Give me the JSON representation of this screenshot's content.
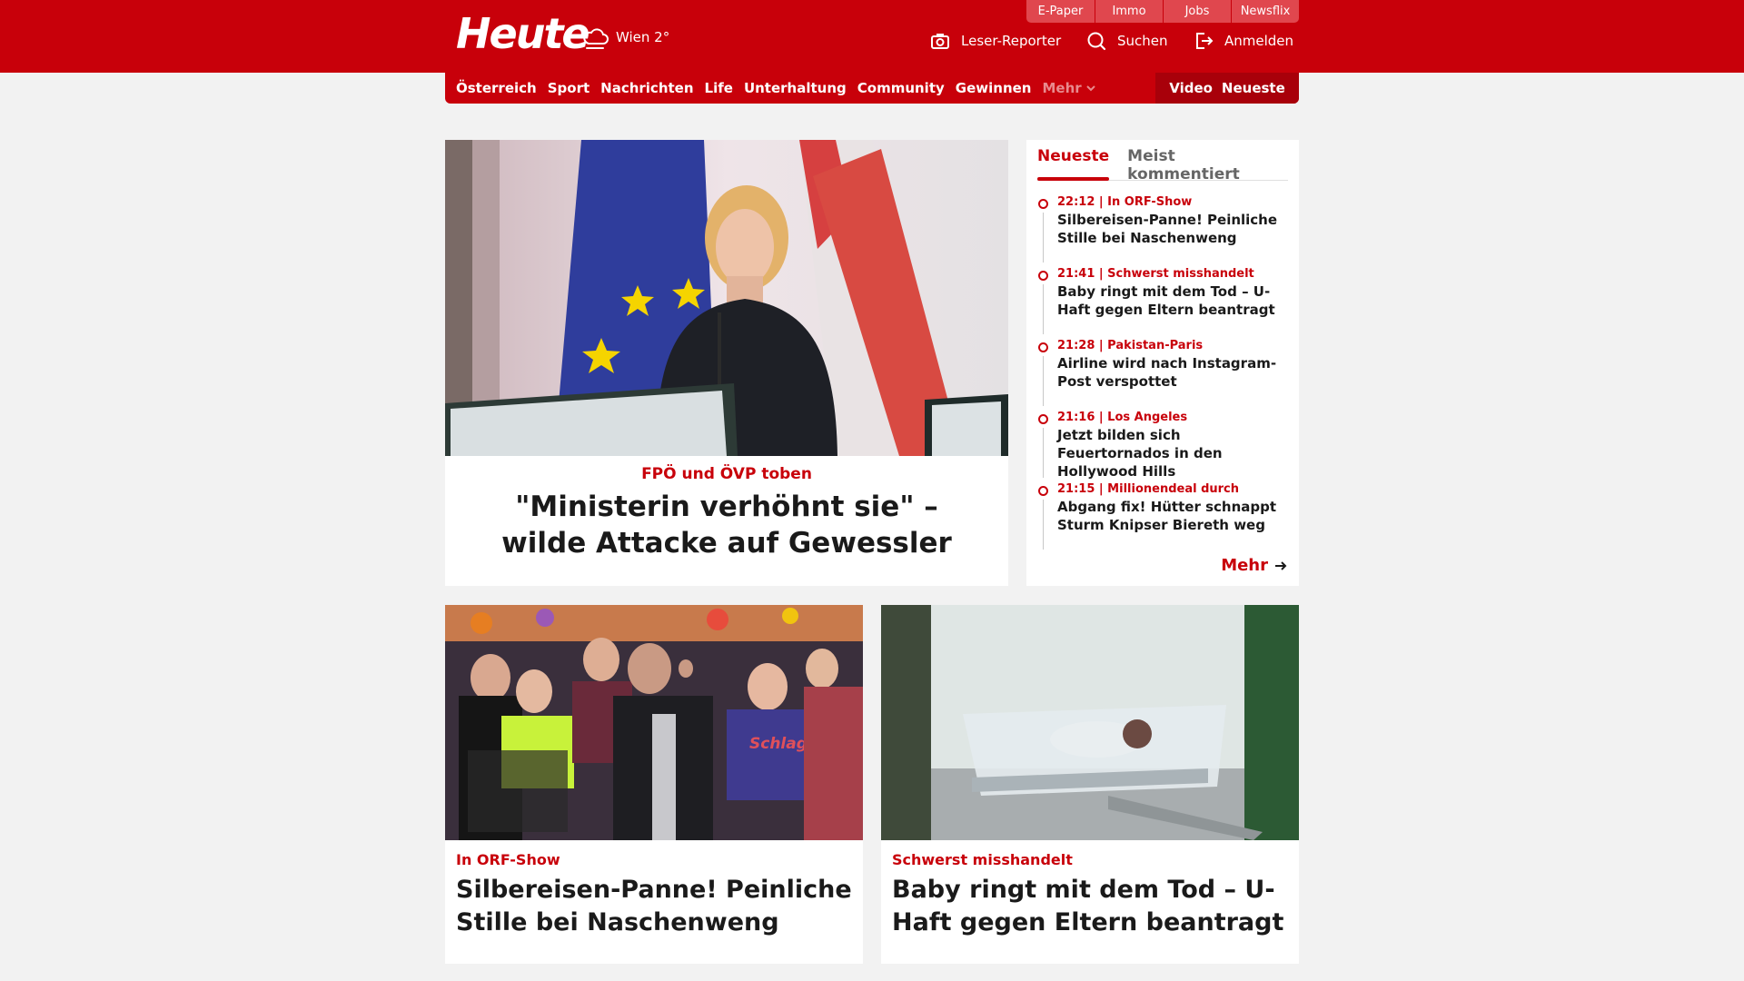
{
  "header": {
    "logo": "Heute",
    "weather": "Wien 2°",
    "quicklinks": [
      "E-Paper",
      "Immo",
      "Jobs",
      "Newsflix"
    ],
    "leser_reporter": "Leser-Reporter",
    "suchen": "Suchen",
    "anmelden": "Anmelden"
  },
  "nav": {
    "items": [
      "Österreich",
      "Sport",
      "Nachrichten",
      "Life",
      "Unterhaltung",
      "Community",
      "Gewinnen"
    ],
    "more": "Mehr",
    "video": "Video",
    "neueste": "Neueste"
  },
  "hero": {
    "kicker": "FPÖ und ÖVP toben",
    "title": "\"Ministerin verhöhnt sie\" – wilde Attacke auf Gewessler"
  },
  "sidebar": {
    "tabs": [
      "Neueste",
      "Meist kommentiert"
    ],
    "items": [
      {
        "meta": "22:12 | In ORF-Show",
        "title": "Silbereisen-Panne! Peinliche Stille bei Naschenweng"
      },
      {
        "meta": "21:41 | Schwerst misshandelt",
        "title": "Baby ringt mit dem Tod – U-Haft gegen Eltern beantragt"
      },
      {
        "meta": "21:28 | Pakistan-Paris",
        "title": "Airline wird nach Instagram-Post verspottet"
      },
      {
        "meta": "21:16 | Los Angeles",
        "title": "Jetzt bilden sich Feuertornados in den Hollywood Hills"
      },
      {
        "meta": "21:15 | Millionendeal durch",
        "title": "Abgang fix! Hütter schnappt Sturm Knipser Biereth weg"
      }
    ],
    "more": "Mehr"
  },
  "cards": [
    {
      "kicker": "In ORF-Show",
      "title": "Silbereisen-Panne! Peinliche Stille bei Naschenweng"
    },
    {
      "kicker": "Schwerst misshandelt",
      "title": "Baby ringt mit dem Tod – U-Haft gegen Eltern beantragt"
    }
  ],
  "colors": {
    "brand_red": "#c8000a",
    "background": "#f2f2f2"
  }
}
